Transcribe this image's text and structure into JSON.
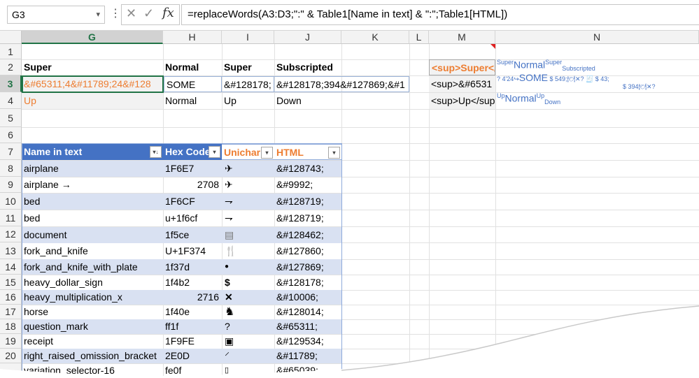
{
  "formula_bar": {
    "name_box": "G3",
    "dots": "⋮",
    "cancel_icon": "✕",
    "enter_icon": "✓",
    "fx_label": "fx",
    "formula": "=replaceWords(A3:D3;\":\" & Table1[Name in text] & \":\";Table1[HTML])"
  },
  "columns": [
    "G",
    "H",
    "I",
    "J",
    "K",
    "L",
    "M",
    "N"
  ],
  "rows": [
    "1",
    "2",
    "3",
    "4",
    "5",
    "6",
    "7",
    "8",
    "9",
    "10",
    "11",
    "12",
    "13",
    "14",
    "15",
    "16",
    "17",
    "18",
    "19",
    "20"
  ],
  "row2": {
    "g": "Super",
    "h": "Normal",
    "i": "Super",
    "j": "Subscripted",
    "m": "<sup>Super</",
    "n_super": "Super",
    "n_normal": "Normal",
    "n_super2": "Super",
    "n_sub": "Subscripted"
  },
  "row3": {
    "g": "&#65311;4&#11789;24&#128",
    "h": "SOME",
    "i": "&#128178;",
    "j": "&#128178;394&#127869;&#1",
    "m": "<sup>&#6531",
    "n_a": "? 4'24↪",
    "n_normal": "SOME",
    "n_b": "$ 549;🍽✕?  🧾 $ 43;",
    "n_c": "$ 394🍽✕?"
  },
  "row4": {
    "g": "Up",
    "h": "Normal",
    "i": "Up",
    "j": "Down",
    "m": "<sup>Up</sup",
    "n_super": "Up",
    "n_normal": "Normal",
    "n_super2": "Up",
    "n_sub": "Down"
  },
  "table": {
    "headers": [
      "Name in text",
      "Hex Code",
      "Unichar",
      "HTML"
    ],
    "rows": [
      {
        "name": "airplane",
        "hex": "1F6E7",
        "icon": "✈",
        "html": "&#128743;"
      },
      {
        "name": "airplane →",
        "hex": "2708",
        "icon": "✈",
        "html": "&#9992;"
      },
      {
        "name": "bed",
        "hex": "1F6CF",
        "icon": "⇁",
        "html": "&#128719;"
      },
      {
        "name": "bed",
        "hex": "u+1f6cf",
        "icon": "⇁",
        "html": "&#128719;"
      },
      {
        "name": "document",
        "hex": "1f5ce",
        "icon": "▤",
        "html": "&#128462;"
      },
      {
        "name": "fork_and_knife",
        "hex": "U+1F374",
        "icon": "🍴",
        "html": "&#127860;"
      },
      {
        "name": "fork_and_knife_with_plate",
        "hex": "1f37d",
        "icon": "●",
        "html": "&#127869;"
      },
      {
        "name": "heavy_dollar_sign",
        "hex": "1f4b2",
        "icon": "$",
        "html": "&#128178;"
      },
      {
        "name": "heavy_multiplication_x",
        "hex": "2716",
        "icon": "✕",
        "html": "&#10006;"
      },
      {
        "name": "horse",
        "hex": "1f40e",
        "icon": "♞",
        "html": "&#128014;"
      },
      {
        "name": "question_mark",
        "hex": "ff1f",
        "icon": "?",
        "html": "&#65311;"
      },
      {
        "name": "receipt",
        "hex": "1F9FE",
        "icon": "▣",
        "html": "&#129534;"
      },
      {
        "name": "right_raised_omission_bracket",
        "hex": "2E0D",
        "icon": "⸍",
        "html": "&#11789;"
      },
      {
        "name": "variation_selector-16",
        "hex": "fe0f",
        "icon": "▯",
        "html": "&#65039;"
      }
    ]
  },
  "colors": {
    "table_header": "#4472c4",
    "band": "#d9e1f2",
    "orange": "#ed7d31",
    "accent": "#217346"
  }
}
